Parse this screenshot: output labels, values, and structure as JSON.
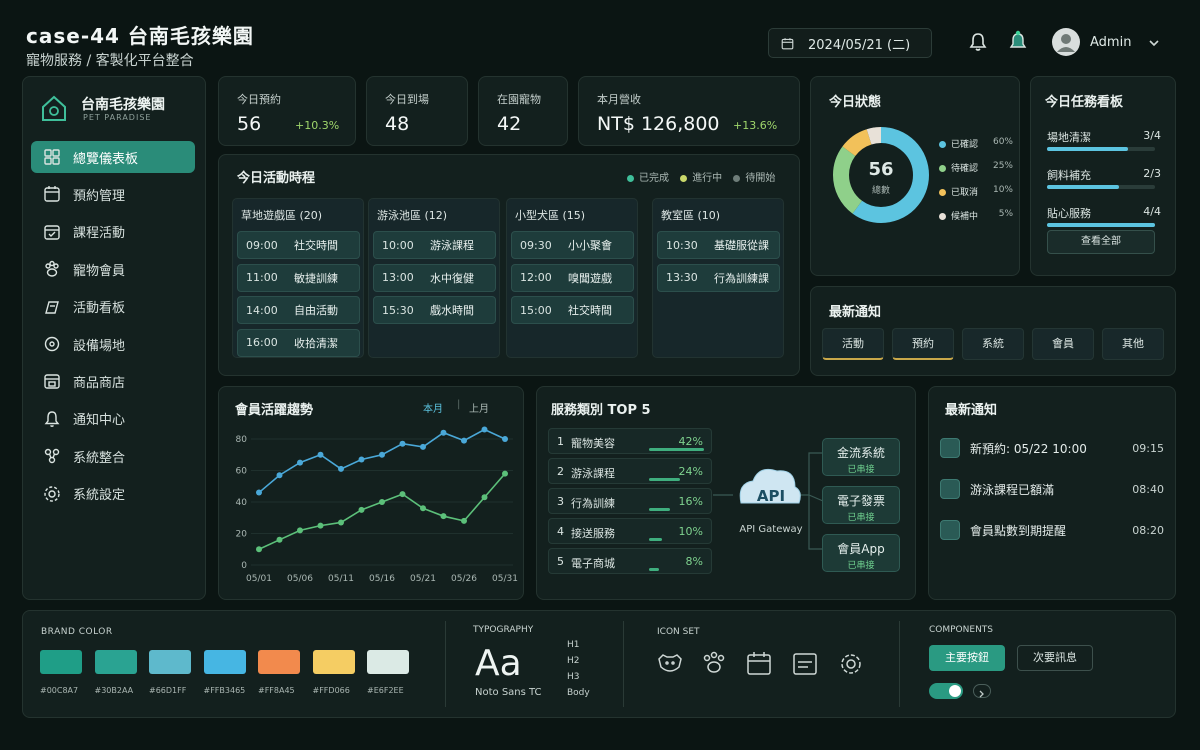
{
  "header": {
    "title": "case-44  台南毛孩樂園",
    "subtitle": "寵物服務 / 客製化平台整合",
    "date": "2024/05/21 (二)",
    "user": "Admin"
  },
  "sidebar": {
    "brand": "台南毛孩樂園",
    "brand_sub": "PET PARADISE",
    "items": [
      {
        "label": "總覽儀表板",
        "icon": "dashboard-icon"
      },
      {
        "label": "預約管理",
        "icon": "calendar-icon"
      },
      {
        "label": "課程活動",
        "icon": "calendar-check-icon"
      },
      {
        "label": "寵物會員",
        "icon": "paw-icon"
      },
      {
        "label": "活動看板",
        "icon": "board-icon"
      },
      {
        "label": "設備場地",
        "icon": "location-icon"
      },
      {
        "label": "商品商店",
        "icon": "store-icon"
      },
      {
        "label": "通知中心",
        "icon": "bell-icon"
      },
      {
        "label": "系統整合",
        "icon": "integration-icon"
      },
      {
        "label": "系統設定",
        "icon": "gear-icon"
      }
    ]
  },
  "stats": [
    {
      "label": "今日預約",
      "value": "56",
      "change": "+10.3%"
    },
    {
      "label": "今日到場",
      "value": "48",
      "change": ""
    },
    {
      "label": "在園寵物",
      "value": "42",
      "change": ""
    },
    {
      "label": "本月營收",
      "value": "NT$ 126,800",
      "change": "+13.6%"
    }
  ],
  "schedule": {
    "title": "今日活動時程",
    "legend": [
      "已完成",
      "進行中",
      "待開始"
    ],
    "columns": [
      {
        "name": "草地遊戲區 (20)",
        "slots": [
          [
            "09:00",
            "社交時間"
          ],
          [
            "11:00",
            "敏捷訓練"
          ],
          [
            "14:00",
            "自由活動"
          ],
          [
            "16:00",
            "收拾清潔"
          ]
        ]
      },
      {
        "name": "游泳池區 (12)",
        "slots": [
          [
            "10:00",
            "游泳課程"
          ],
          [
            "13:00",
            "水中復健"
          ],
          [
            "15:30",
            "戲水時間"
          ]
        ]
      },
      {
        "name": "小型犬區 (15)",
        "slots": [
          [
            "09:30",
            "小小聚會"
          ],
          [
            "12:00",
            "嗅聞遊戲"
          ],
          [
            "15:00",
            "社交時間"
          ]
        ]
      },
      {
        "name": "教室區 (10)",
        "slots": [
          [
            "10:30",
            "基礎服從課"
          ],
          [
            "13:30",
            "行為訓練課"
          ]
        ]
      }
    ]
  },
  "occupancy": {
    "title": "今日狀態",
    "total": "56",
    "total_label": "總數",
    "items": [
      {
        "label": "已確認",
        "pct": "60%",
        "value": 60,
        "color": "#5cc4e0"
      },
      {
        "label": "待確認",
        "pct": "25%",
        "value": 25,
        "color": "#8fd08a"
      },
      {
        "label": "已取消",
        "pct": "10%",
        "value": 10,
        "color": "#f2c15a"
      },
      {
        "label": "候補中",
        "pct": "5%",
        "value": 5,
        "color": "#e8e1d8"
      }
    ]
  },
  "tasks": {
    "title": "今日任務看板",
    "items": [
      {
        "label": "場地清潔",
        "count": "3/4",
        "progress": 0.75
      },
      {
        "label": "飼料補充",
        "count": "2/3",
        "progress": 0.67
      },
      {
        "label": "貼心服務",
        "count": "4/4",
        "progress": 1.0
      }
    ],
    "button": "查看全部"
  },
  "recent_notice": {
    "title": "最新通知",
    "tabs": [
      "活動",
      "預約",
      "系統",
      "會員",
      "其他"
    ]
  },
  "member_trend": {
    "title": "會員活躍趨勢",
    "tab_active": "本月",
    "tab_other": "上月"
  },
  "chart_data": {
    "type": "line",
    "x": [
      "05/01",
      "05/04",
      "05/06",
      "05/09",
      "05/11",
      "05/14",
      "05/16",
      "05/19",
      "05/21",
      "05/24",
      "05/26",
      "05/29",
      "05/31"
    ],
    "x_ticks": [
      "05/01",
      "05/06",
      "05/11",
      "05/16",
      "05/21",
      "05/26",
      "05/31"
    ],
    "series": [
      {
        "values": [
          46,
          57,
          65,
          70,
          61,
          67,
          70,
          77,
          75,
          84,
          79,
          86,
          80
        ],
        "color": "#4aa8d8"
      },
      {
        "values": [
          10,
          16,
          22,
          25,
          27,
          35,
          40,
          45,
          36,
          31,
          28,
          43,
          58
        ],
        "color": "#5cc07a"
      }
    ],
    "ylim": [
      0,
      80
    ],
    "yticks": [
      0,
      20,
      40,
      60,
      80
    ],
    "grid": true
  },
  "services": {
    "title": "服務類別 TOP 5",
    "items": [
      {
        "rank": "1",
        "name": "寵物美容",
        "pct": "42%",
        "value": 42
      },
      {
        "rank": "2",
        "name": "游泳課程",
        "pct": "24%",
        "value": 24
      },
      {
        "rank": "3",
        "name": "行為訓練",
        "pct": "16%",
        "value": 16
      },
      {
        "rank": "4",
        "name": "接送服務",
        "pct": "10%",
        "value": 10
      },
      {
        "rank": "5",
        "name": "電子商城",
        "pct": "8%",
        "value": 8
      }
    ],
    "api_label": "API",
    "api_sub": "API Gateway",
    "systems": [
      {
        "name": "金流系統",
        "status": "已串接"
      },
      {
        "name": "電子發票",
        "status": "已串接"
      },
      {
        "name": "會員App",
        "status": "已串接"
      }
    ]
  },
  "notifications": {
    "title": "最新通知",
    "items": [
      {
        "text": "新預約: 05/22 10:00",
        "time": "09:15"
      },
      {
        "text": "游泳課程已額滿",
        "time": "08:40"
      },
      {
        "text": "會員點數到期提醒",
        "time": "08:20"
      }
    ]
  },
  "design": {
    "brand_label": "BRAND COLOR",
    "colors": [
      {
        "hex": "#00C8A7",
        "swatch": "#1f9e87"
      },
      {
        "hex": "#30B2AA",
        "swatch": "#2aa392"
      },
      {
        "hex": "#66D1FF",
        "swatch": "#5eb9cc"
      },
      {
        "hex": "#FFB3465",
        "swatch": "#46b6e3"
      },
      {
        "hex": "#FF8A45",
        "swatch": "#f28a4d"
      },
      {
        "hex": "#FFD066",
        "swatch": "#f5cd63"
      },
      {
        "hex": "#E6F2EE",
        "swatch": "#dbeae5"
      }
    ],
    "typo_label": "TYPOGRAPHY",
    "typo_sample": "Aa",
    "typo_font": "Noto Sans TC",
    "typo_levels": [
      "H1",
      "H2",
      "H3",
      "Body"
    ],
    "icon_label": "ICON SET",
    "components_label": "COMPONENTS",
    "primary_btn": "主要按鈕",
    "secondary_btn": "次要訊息"
  }
}
